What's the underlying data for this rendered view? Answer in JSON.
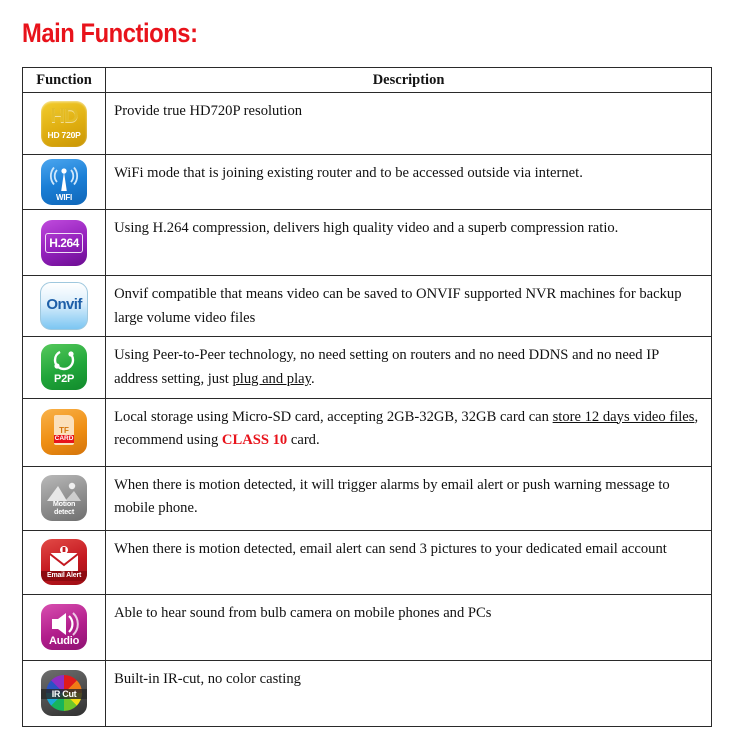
{
  "title": "Main Functions:",
  "table": {
    "headers": {
      "function": "Function",
      "description": "Description"
    },
    "rows": [
      {
        "icon_name": "hd-720p-icon",
        "icon_big_text": "HD",
        "icon_caption": "HD 720P",
        "icon_color": "#dfae10",
        "description": "Provide true HD720P resolution"
      },
      {
        "icon_name": "wifi-icon",
        "icon_caption": "WIFI",
        "icon_color": "#1b7fd6",
        "description": "WiFi mode that is joining existing router and to be accessed outside via internet."
      },
      {
        "icon_name": "h264-icon",
        "icon_label": "H.264",
        "icon_color": "#9220bb",
        "description": "Using H.264 compression, delivers high quality video and a superb compression ratio."
      },
      {
        "icon_name": "onvif-icon",
        "icon_label": "Onvif",
        "icon_color": "#7cc6f2",
        "description": "Onvif compatible that means video can be saved to ONVIF supported NVR machines for backup large volume video files"
      },
      {
        "icon_name": "p2p-icon",
        "icon_caption": "P2P",
        "icon_color": "#21a63a",
        "description_part1": "Using Peer-to-Peer technology, no need setting on routers and no need DDNS and no need IP address setting, just ",
        "description_underline": "plug and play",
        "description_part2": "."
      },
      {
        "icon_name": "tf-card-icon",
        "icon_caption_top": "TF",
        "icon_caption_bottom": "CARD",
        "icon_color": "#ef8f14",
        "description_part1": "Local storage using Micro-SD card, accepting 2GB-32GB, 32GB card can ",
        "description_underline": "store 12 days video files",
        "description_part2": ", recommend using ",
        "description_red": "CLASS 10",
        "description_part3": " card."
      },
      {
        "icon_name": "motion-detect-icon",
        "icon_caption_line1": "Motion",
        "icon_caption_line2": "detect",
        "icon_color": "#8e8e8e",
        "description": "When there is motion detected, it will trigger alarms by email alert or push warning message to mobile phone."
      },
      {
        "icon_name": "email-alert-icon",
        "icon_caption": "Email Alert",
        "icon_color": "#c41820",
        "description": "When there is motion detected, email alert can send 3 pictures to your dedicated email account"
      },
      {
        "icon_name": "audio-icon",
        "icon_caption": "Audio",
        "icon_color": "#b21e8c",
        "description": "Able to hear sound from bulb camera on mobile phones and PCs"
      },
      {
        "icon_name": "ir-cut-icon",
        "icon_caption": "IR Cut",
        "icon_color": "#4a4a4a",
        "description": "Built-in IR-cut, no color casting"
      }
    ]
  }
}
